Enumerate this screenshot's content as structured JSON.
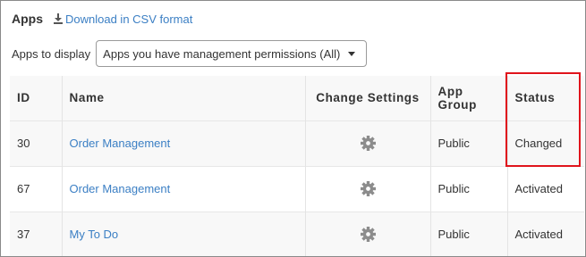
{
  "header": {
    "title": "Apps",
    "csv_link": "Download in CSV format",
    "csv_icon": "download-icon"
  },
  "filter": {
    "label": "Apps to display",
    "selected": "Apps you have management permissions (All)"
  },
  "table": {
    "columns": {
      "id": "ID",
      "name": "Name",
      "change_settings": "Change Settings",
      "app_group_line1": "App",
      "app_group_line2": "Group",
      "status": "Status"
    },
    "rows": [
      {
        "id": "30",
        "name": "Order Management",
        "settings_icon": "gear-icon",
        "group": "Public",
        "status": "Changed"
      },
      {
        "id": "67",
        "name": "Order Management",
        "settings_icon": "gear-icon",
        "group": "Public",
        "status": "Activated"
      },
      {
        "id": "37",
        "name": "My To Do",
        "settings_icon": "gear-icon",
        "group": "Public",
        "status": "Activated"
      }
    ]
  },
  "colors": {
    "link": "#3b7fc4",
    "highlight_box": "#e0141c",
    "gear": "#8c8c8c"
  }
}
